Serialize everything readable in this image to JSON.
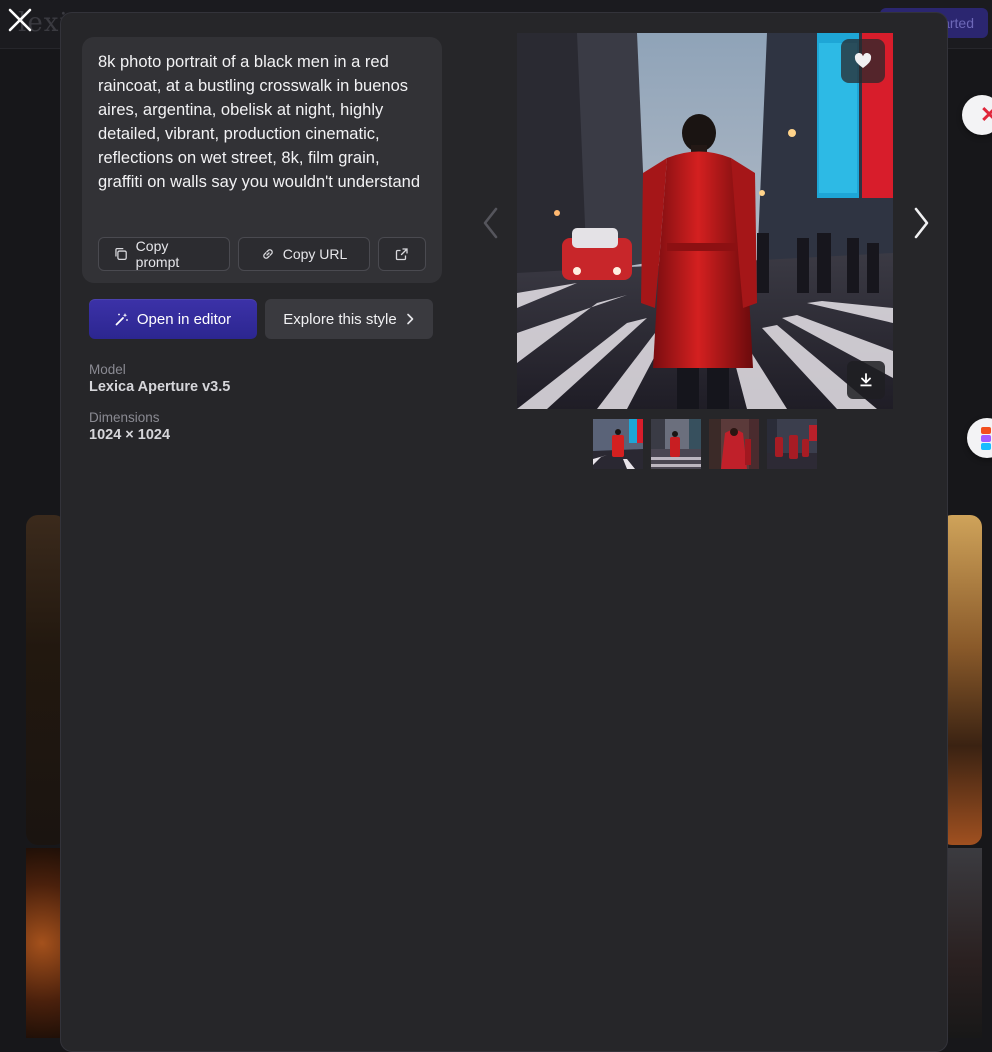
{
  "background": {
    "logo_text": "lexi",
    "cta_label": "Get started"
  },
  "prompt": {
    "text": "8k photo portrait of a black men in a red raincoat, at a bustling crosswalk in buenos aires, argentina, obelisk at night, highly detailed, vibrant, production cinematic, reflections on wet street, 8k, film grain, graffiti on walls say you wouldn't understand"
  },
  "actions": {
    "copy_prompt": "Copy prompt",
    "copy_url": "Copy URL",
    "open_editor": "Open in editor",
    "explore_style": "Explore this style"
  },
  "details": {
    "model_label": "Model",
    "model_value": "Lexica Aperture v3.5",
    "dimensions_label": "Dimensions",
    "dimensions_value": "1024 × 1024"
  },
  "thumbnails": [
    {
      "name": "thumbnail-1",
      "selected": true
    },
    {
      "name": "thumbnail-2",
      "selected": false
    },
    {
      "name": "thumbnail-3",
      "selected": false
    },
    {
      "name": "thumbnail-4",
      "selected": false
    }
  ],
  "icons": [
    "close-icon",
    "copy-icon",
    "link-icon",
    "external-link-icon",
    "magic-wand-icon",
    "chevron-right-icon",
    "heart-icon",
    "download-icon",
    "chevron-left-icon"
  ],
  "colors": {
    "accent": "#3c32a8",
    "modal_bg": "#262629",
    "card_bg": "#323236"
  }
}
